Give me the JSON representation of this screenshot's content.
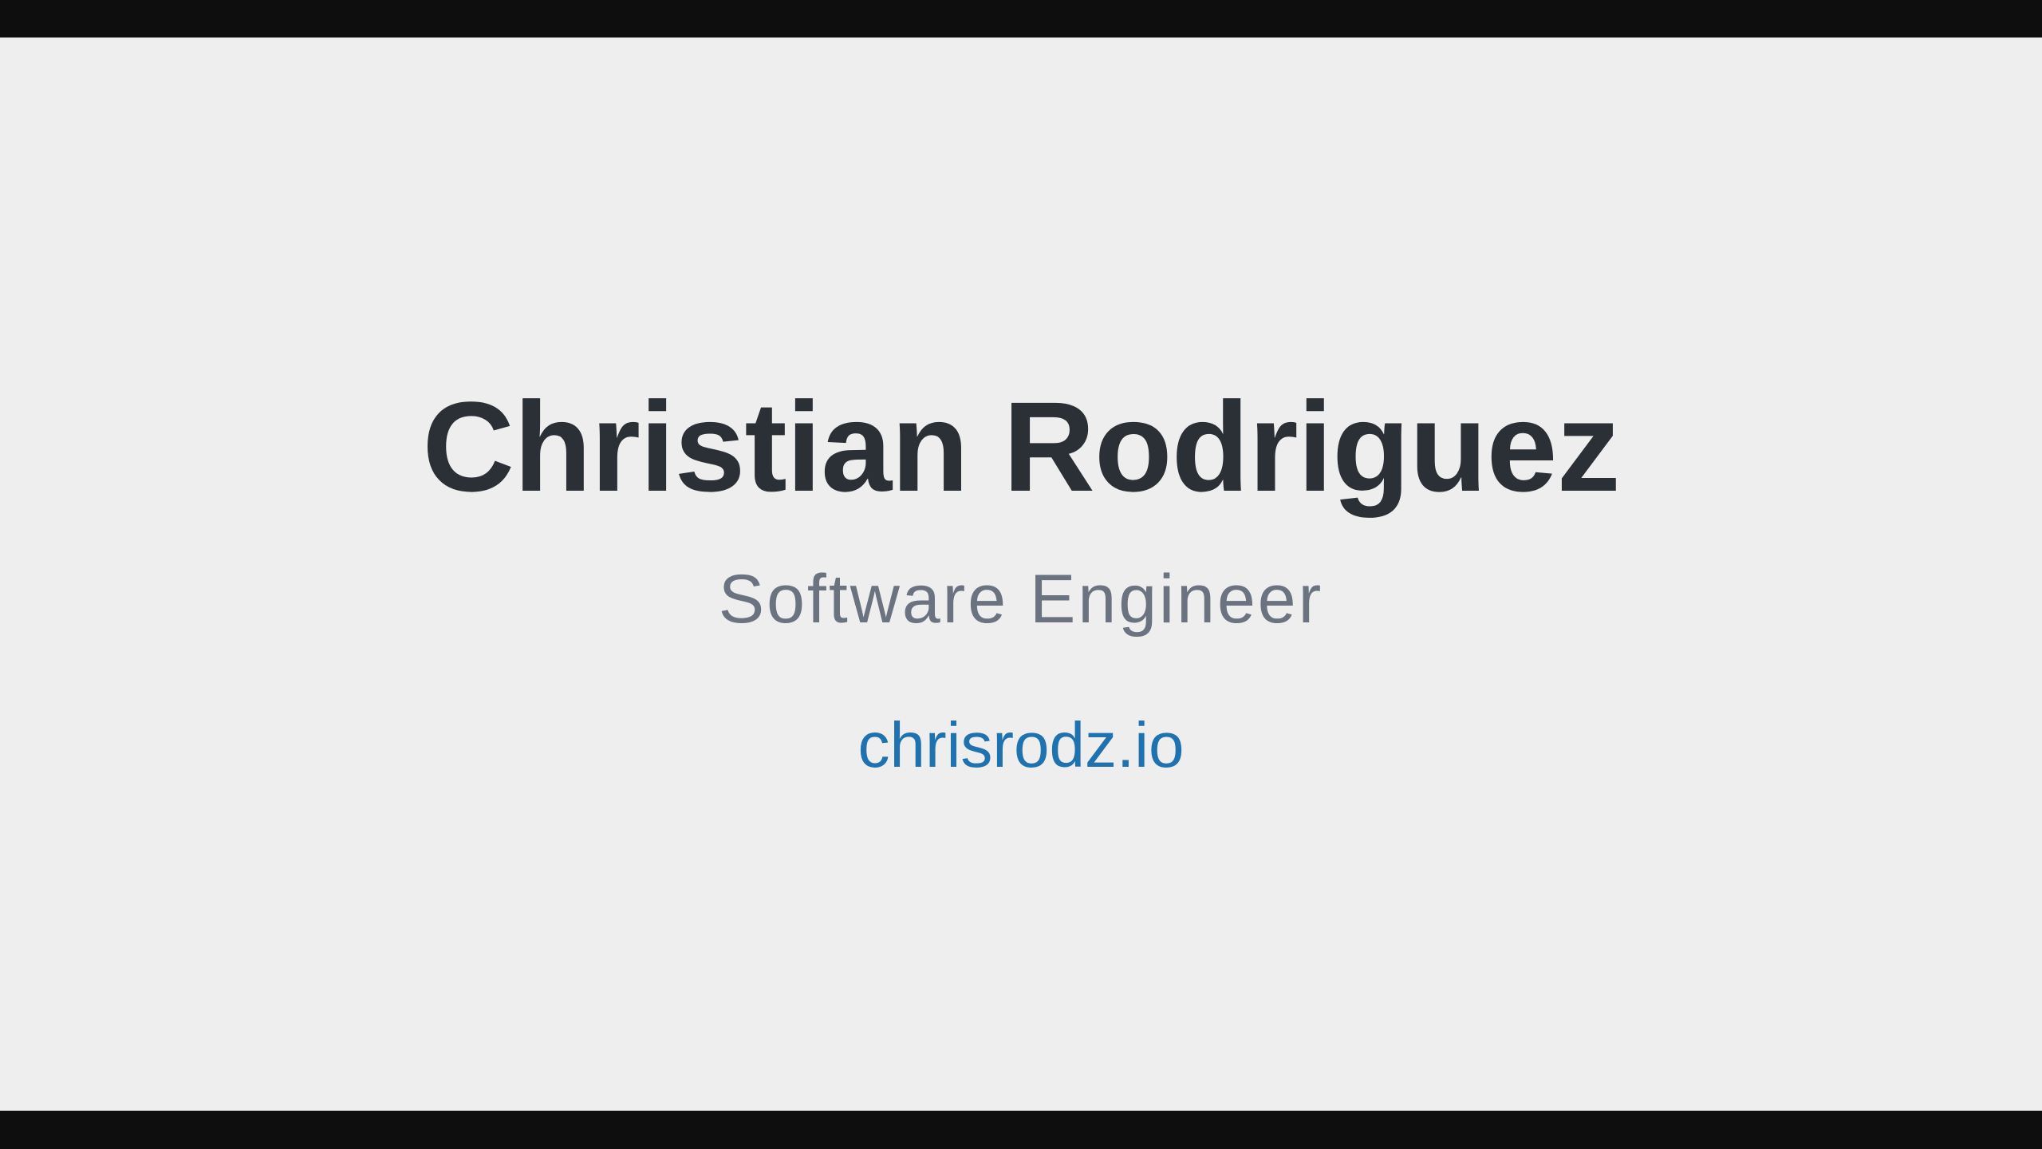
{
  "profile": {
    "name": "Christian Rodriguez",
    "role": "Software Engineer",
    "website": "chrisrodz.io"
  },
  "colors": {
    "background": "#eeeeee",
    "letterbox": "#0e0e0e",
    "name_text": "#2b2f36",
    "role_text": "#6b7280",
    "link_text": "#1f72b0"
  }
}
